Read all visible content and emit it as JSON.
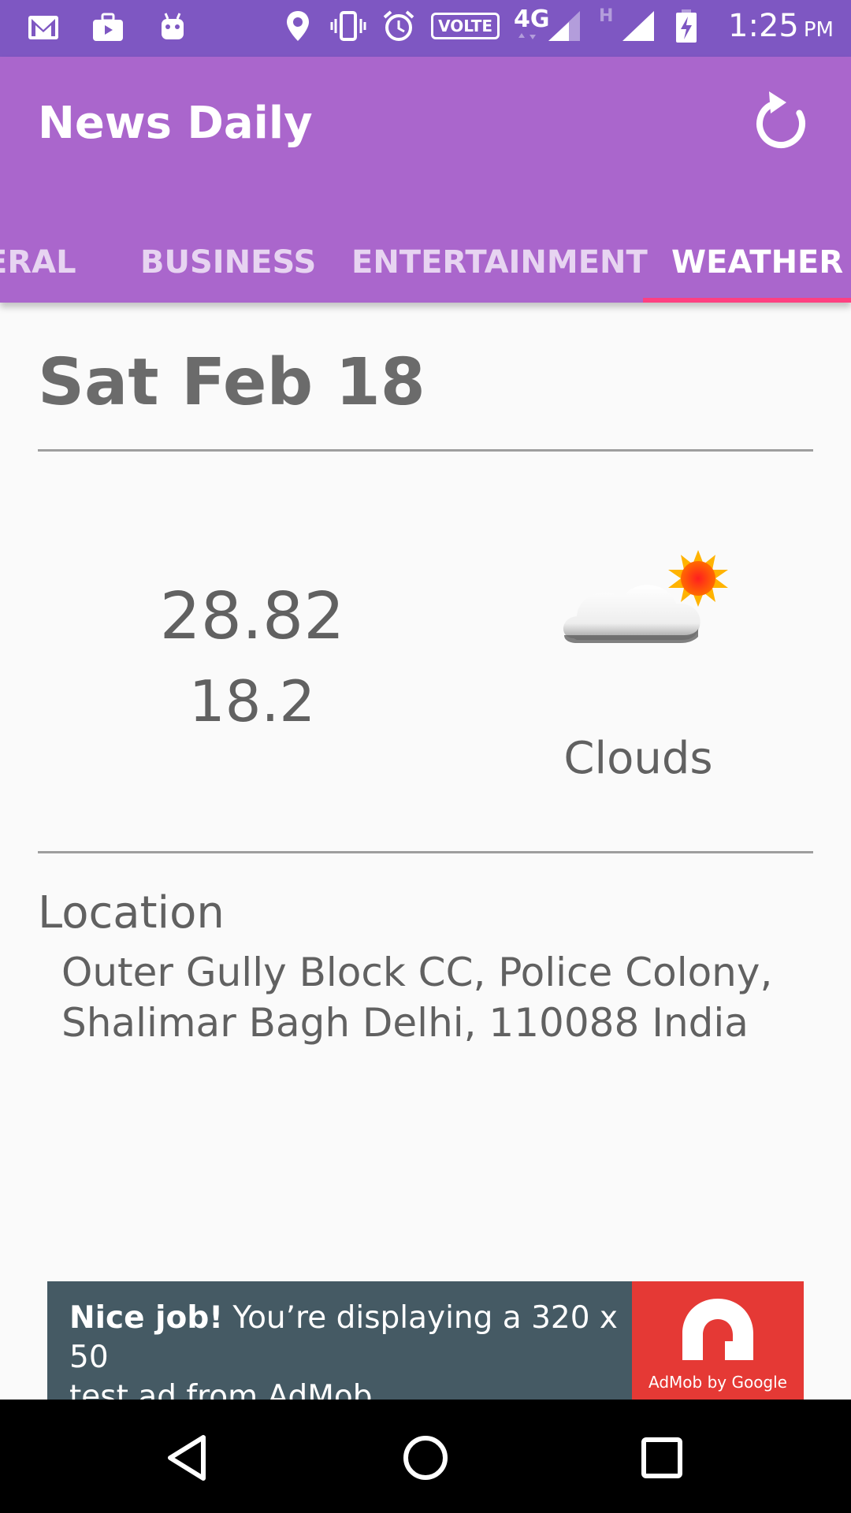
{
  "status_bar": {
    "time": "1:25",
    "ampm": "PM",
    "network": "4G",
    "volte": "VOLTE",
    "signal_secondary": "H",
    "left_icons": [
      "gmail-icon",
      "briefcase-icon",
      "android-icon"
    ],
    "right_icons": [
      "location-icon",
      "vibrate-icon",
      "alarm-icon",
      "volte-icon",
      "signal-4g-icon",
      "signal-h-icon",
      "battery-charging-icon"
    ]
  },
  "app_bar": {
    "title": "News Daily",
    "refresh_icon": "refresh-icon",
    "color": "#aa66cc"
  },
  "tabs": [
    {
      "label": "ERAL",
      "active": false
    },
    {
      "label": "BUSINESS",
      "active": false
    },
    {
      "label": "ENTERTAINMENT",
      "active": false
    },
    {
      "label": "WEATHER",
      "active": true
    }
  ],
  "tab_indicator_color": "#ff4081",
  "weather": {
    "date": "Sat Feb 18",
    "temp_max": "28.82",
    "temp_min": "18.2",
    "condition": "Clouds",
    "condition_icon": "cloud-sun-icon",
    "location_label": "Location",
    "location_line1": "Outer Gully Block CC, Police Colony,",
    "location_line2": "Shalimar Bagh Delhi, 110088 India"
  },
  "ad": {
    "bold": "Nice job!",
    "text_line1": " You’re displaying a 320 x 50",
    "text_line2": "test ad from AdMob.",
    "brand": "AdMob by Google",
    "background": "#455a64",
    "logo_background": "#e53935"
  },
  "nav_bar": {
    "icons": [
      "back-icon",
      "home-icon",
      "recents-icon"
    ]
  }
}
